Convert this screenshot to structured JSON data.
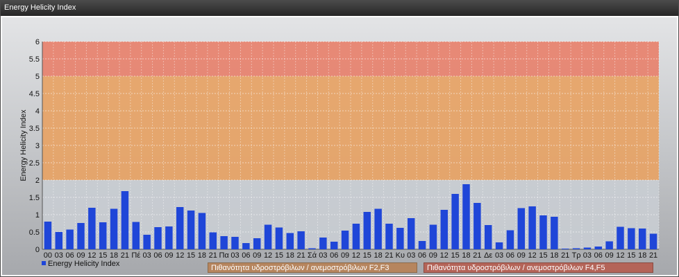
{
  "window": {
    "title": "Energy Helicity Index"
  },
  "legend": {
    "series_label": "Energy Helicity Index"
  },
  "band_labels": {
    "f2f3": "Πιθανότητα υδροστρόβιλων / ανεμοστρόβιλων F2,F3",
    "f4f5": "Πιθανότητα υδροστρόβιλων / ανεμοστρόβιλων F4,F5"
  },
  "colors": {
    "bar": "#1f46d8",
    "band_low": "#c9cdd3",
    "band_mid": "#e8a263",
    "band_high": "#e8806a"
  },
  "chart_data": {
    "type": "bar",
    "title": "",
    "xlabel": "",
    "ylabel": "Energy Helicity Index",
    "ylim": [
      0,
      6
    ],
    "yticks": [
      "0",
      "0.5",
      "1",
      "1.5",
      "2",
      "2.5",
      "3",
      "3.5",
      "4",
      "4.5",
      "5",
      "5.5",
      "6"
    ],
    "grid": true,
    "legend_position": "bottom-left",
    "bands": [
      {
        "from": 0,
        "to": 2,
        "color": "#c9cdd3"
      },
      {
        "from": 2,
        "to": 5,
        "color": "#e8a263"
      },
      {
        "from": 5,
        "to": 6,
        "color": "#e8806a"
      }
    ],
    "categories": [
      "00",
      "03",
      "06",
      "09",
      "12",
      "15",
      "18",
      "21",
      "Πέ",
      "03",
      "06",
      "09",
      "12",
      "15",
      "18",
      "21",
      "Πα",
      "03",
      "06",
      "09",
      "12",
      "15",
      "18",
      "21",
      "Σά",
      "03",
      "06",
      "09",
      "12",
      "15",
      "18",
      "21",
      "Κυ",
      "03",
      "06",
      "09",
      "12",
      "15",
      "18",
      "21",
      "Δε",
      "03",
      "06",
      "09",
      "12",
      "15",
      "18",
      "21",
      "Τρ",
      "03",
      "06",
      "09",
      "12",
      "15",
      "18",
      "21"
    ],
    "series": [
      {
        "name": "Energy Helicity Index",
        "values": [
          0.8,
          0.5,
          0.57,
          0.76,
          1.2,
          0.78,
          1.17,
          1.68,
          0.79,
          0.42,
          0.64,
          0.66,
          1.22,
          1.12,
          1.05,
          0.49,
          0.38,
          0.36,
          0.18,
          0.32,
          0.71,
          0.63,
          0.47,
          0.52,
          0.03,
          0.34,
          0.22,
          0.54,
          0.74,
          1.08,
          1.17,
          0.74,
          0.62,
          0.9,
          0.24,
          0.71,
          1.14,
          1.6,
          1.88,
          1.34,
          0.7,
          0.2,
          0.55,
          1.19,
          1.24,
          0.98,
          0.94,
          0.02,
          0.03,
          0.05,
          0.08,
          0.23,
          0.65,
          0.61,
          0.6,
          0.45
        ]
      }
    ]
  }
}
